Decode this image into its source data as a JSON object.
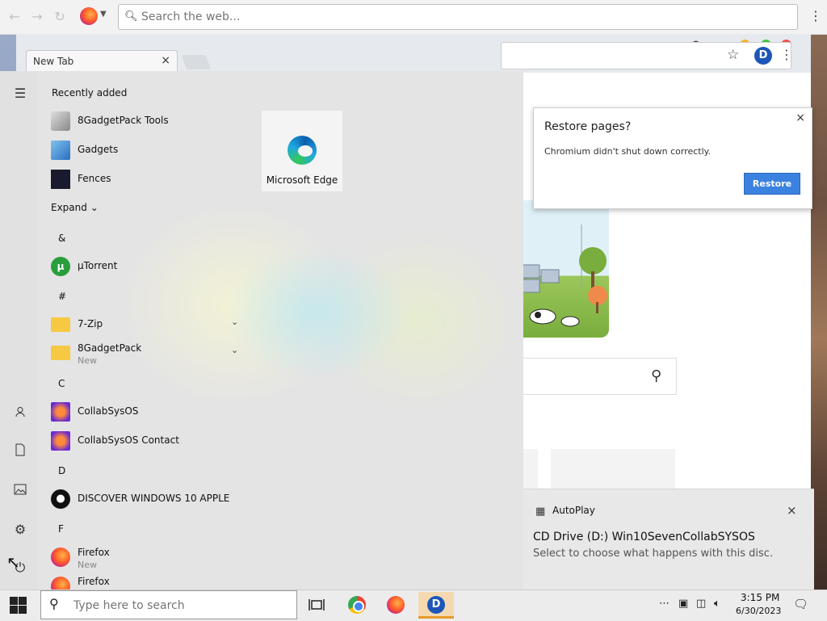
{
  "browser": {
    "search_placeholder": "Search the web...",
    "menu_icon": "⋮"
  },
  "chromium": {
    "tab_title": "New Tab",
    "tab_close": "×",
    "restore": {
      "title": "Restore pages?",
      "message": "Chromium didn't shut down correctly.",
      "button": "Restore",
      "close": "×"
    },
    "ext_letter": "D"
  },
  "start_menu": {
    "recently_added": "Recently added",
    "recent": [
      {
        "label": "8GadgetPack Tools"
      },
      {
        "label": "Gadgets"
      },
      {
        "label": "Fences"
      }
    ],
    "expand": "Expand",
    "groups": [
      {
        "letter": "&",
        "apps": [
          {
            "label": "µTorrent"
          }
        ]
      },
      {
        "letter": "#",
        "apps": [
          {
            "label": "7-Zip"
          },
          {
            "label": "8GadgetPack",
            "sub": "New"
          }
        ]
      },
      {
        "letter": "C",
        "apps": [
          {
            "label": "CollabSysOS"
          },
          {
            "label": "CollabSysOS Contact"
          }
        ]
      },
      {
        "letter": "D",
        "apps": [
          {
            "label": "DISCOVER WINDOWS 10 APPLE"
          }
        ]
      },
      {
        "letter": "F",
        "apps": [
          {
            "label": "Firefox",
            "sub": "New"
          },
          {
            "label": "Firefox"
          }
        ]
      }
    ],
    "tile_label": "Microsoft Edge"
  },
  "autoplay": {
    "title": "AutoPlay",
    "heading": "CD Drive (D:) Win10SevenCollabSYSOS",
    "message": "Select to choose what happens with this disc.",
    "close": "×"
  },
  "taskbar": {
    "search_placeholder": "Type here to search",
    "time": "3:15 PM",
    "date": "6/30/2023",
    "overflow": "⋯"
  },
  "colors": {
    "accent_blue": "#3b82e0",
    "mac_yellow": "#f5b52a",
    "mac_green": "#3cc940",
    "mac_red": "#f0524f"
  }
}
